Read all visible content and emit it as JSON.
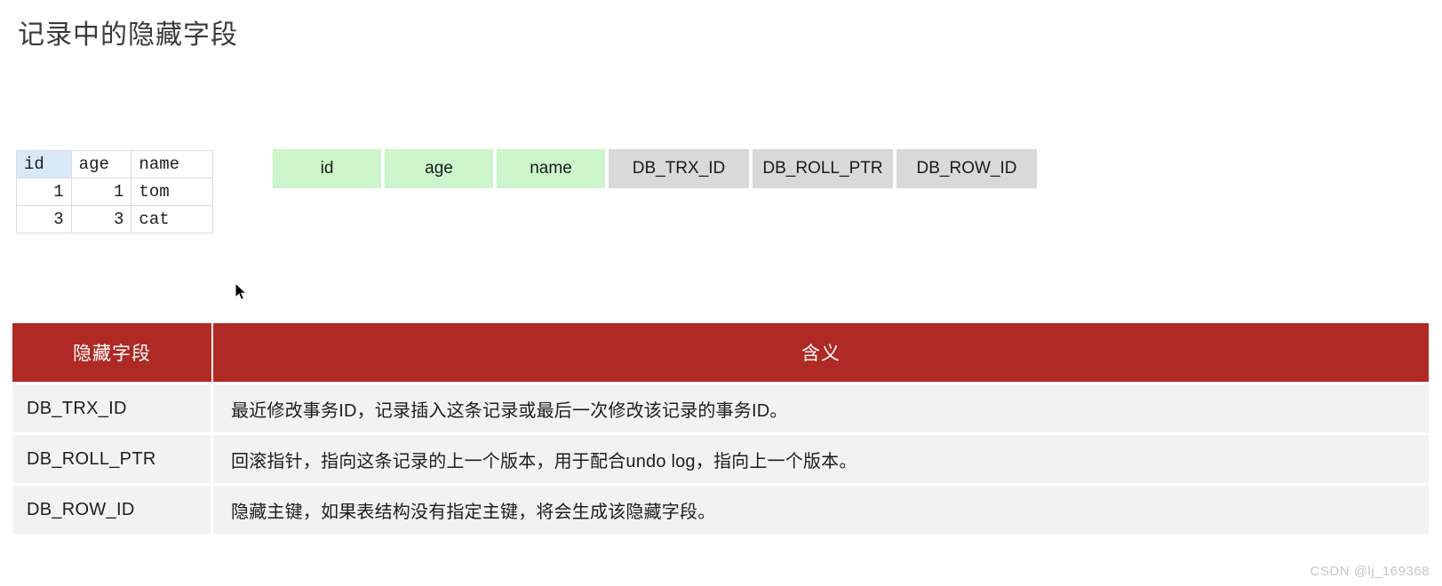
{
  "page": {
    "title": "记录中的隐藏字段",
    "watermark": "CSDN @lj_169368"
  },
  "mini_grid": {
    "headers": [
      "id",
      "age",
      "name"
    ],
    "rows": [
      {
        "id": "1",
        "age": "1",
        "name": "tom"
      },
      {
        "id": "3",
        "age": "3",
        "name": "cat"
      }
    ]
  },
  "field_row": {
    "user_fields": [
      {
        "label": "id",
        "color": "#ccf5cc"
      },
      {
        "label": "age",
        "color": "#ccf5cc"
      },
      {
        "label": "name",
        "color": "#ccf5cc"
      }
    ],
    "hidden_fields": [
      {
        "label": "DB_TRX_ID",
        "color": "#d9d9d9"
      },
      {
        "label": "DB_ROLL_PTR",
        "color": "#d9d9d9"
      },
      {
        "label": "DB_ROW_ID",
        "color": "#d9d9d9"
      }
    ]
  },
  "desc_table": {
    "header_color": "#AF2A25",
    "headers": [
      "隐藏字段",
      "含义"
    ],
    "rows": [
      {
        "field": "DB_TRX_ID",
        "meaning": "最近修改事务ID，记录插入这条记录或最后一次修改该记录的事务ID。"
      },
      {
        "field": "DB_ROLL_PTR",
        "meaning": "回滚指针，指向这条记录的上一个版本，用于配合undo log，指向上一个版本。"
      },
      {
        "field": "DB_ROW_ID",
        "meaning": "隐藏主键，如果表结构没有指定主键，将会生成该隐藏字段。"
      }
    ]
  }
}
